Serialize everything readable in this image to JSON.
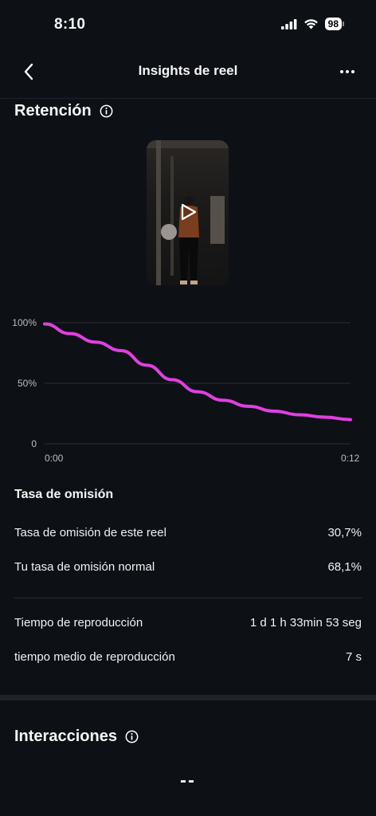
{
  "status_bar": {
    "time": "8:10",
    "battery": "98"
  },
  "header": {
    "title": "Insights de reel"
  },
  "retention": {
    "title": "Retención",
    "chart_data": {
      "type": "line",
      "title": "",
      "xlabel": "",
      "ylabel": "",
      "x_ticks": [
        "0:00",
        "0:12"
      ],
      "y_ticks": [
        "100%",
        "50%",
        "0"
      ],
      "ylim": [
        0,
        100
      ],
      "xlim": [
        0,
        12
      ],
      "grid": true,
      "color": "#e040e0",
      "series": [
        {
          "x": [
            0,
            1,
            2,
            3,
            4,
            5,
            6,
            7,
            8,
            9,
            10,
            11,
            12
          ],
          "values": [
            99,
            91,
            84,
            77,
            65,
            53,
            43,
            36,
            31,
            27,
            24,
            22,
            20
          ]
        }
      ]
    }
  },
  "skip_rate": {
    "title": "Tasa de omisión",
    "rows": [
      {
        "label": "Tasa de omisión de este reel",
        "value": "30,7%"
      },
      {
        "label": "Tu tasa de omisión normal",
        "value": "68,1%"
      }
    ]
  },
  "playback": {
    "rows": [
      {
        "label": "Tiempo de reproducción",
        "value": "1 d 1 h 33min 53 seg"
      },
      {
        "label": "tiempo medio de reproducción",
        "value": "7 s"
      }
    ]
  },
  "interactions": {
    "title": "Interacciones",
    "value": "--"
  }
}
